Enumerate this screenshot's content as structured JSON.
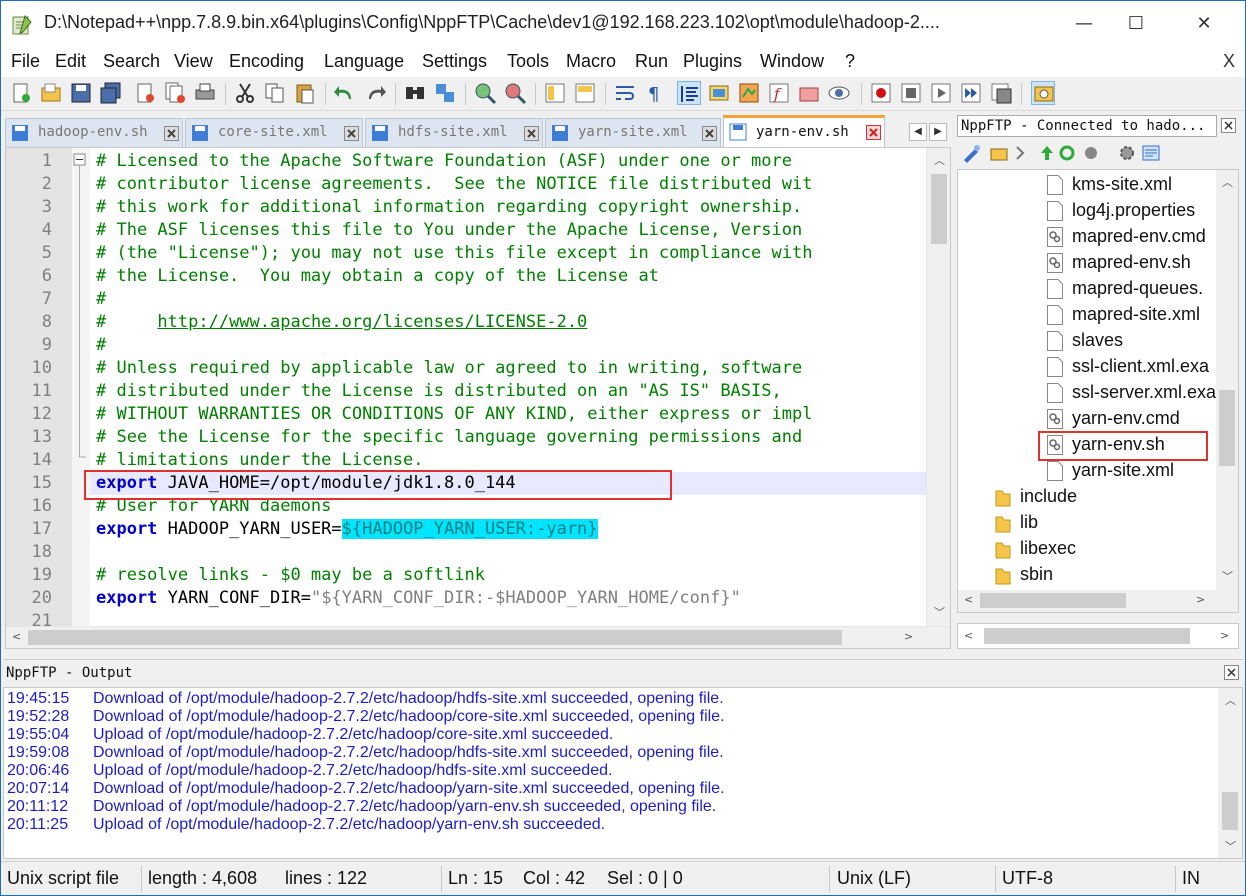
{
  "window": {
    "title": "D:\\Notepad++\\npp.7.8.9.bin.x64\\plugins\\Config\\NppFTP\\Cache\\dev1@192.168.223.102\\opt\\module\\hadoop-2....",
    "minimize": "—",
    "maximize": "☐",
    "close": "✕"
  },
  "menu": {
    "items": [
      "File",
      "Edit",
      "Search",
      "View",
      "Encoding",
      "Language",
      "Settings",
      "Tools",
      "Macro",
      "Run",
      "Plugins",
      "Window",
      "?"
    ],
    "close": "X"
  },
  "tabs": [
    {
      "label": "hadoop-env.sh",
      "active": false
    },
    {
      "label": "core-site.xml",
      "active": false
    },
    {
      "label": "hdfs-site.xml",
      "active": false
    },
    {
      "label": "yarn-site.xml",
      "active": false
    },
    {
      "label": "yarn-env.sh",
      "active": true
    }
  ],
  "tab_scroll": {
    "left": "◀",
    "right": "▶"
  },
  "editor": {
    "line_numbers": [
      "1",
      "2",
      "3",
      "4",
      "5",
      "6",
      "7",
      "8",
      "9",
      "10",
      "11",
      "12",
      "13",
      "14",
      "15",
      "16",
      "17",
      "18",
      "19",
      "20",
      "21"
    ],
    "current_line": 15,
    "lines": [
      {
        "segments": [
          {
            "cls": "cmt",
            "text": "# Licensed to the Apache Software Foundation (ASF) under one or more"
          }
        ]
      },
      {
        "segments": [
          {
            "cls": "cmt",
            "text": "# contributor license agreements.  See the NOTICE file distributed wit"
          }
        ]
      },
      {
        "segments": [
          {
            "cls": "cmt",
            "text": "# this work for additional information regarding copyright ownership."
          }
        ]
      },
      {
        "segments": [
          {
            "cls": "cmt",
            "text": "# The ASF licenses this file to You under the Apache License, Version"
          }
        ]
      },
      {
        "segments": [
          {
            "cls": "cmt",
            "text": "# (the \"License\"); you may not use this file except in compliance with"
          }
        ]
      },
      {
        "segments": [
          {
            "cls": "cmt",
            "text": "# the License.  You may obtain a copy of the License at"
          }
        ]
      },
      {
        "segments": [
          {
            "cls": "cmt",
            "text": "#"
          }
        ]
      },
      {
        "segments": [
          {
            "cls": "cmt",
            "text": "#     "
          },
          {
            "cls": "link",
            "text": "http://www.apache.org/licenses/LICENSE-2.0"
          }
        ]
      },
      {
        "segments": [
          {
            "cls": "cmt",
            "text": "#"
          }
        ]
      },
      {
        "segments": [
          {
            "cls": "cmt",
            "text": "# Unless required by applicable law or agreed to in writing, software"
          }
        ]
      },
      {
        "segments": [
          {
            "cls": "cmt",
            "text": "# distributed under the License is distributed on an \"AS IS\" BASIS,"
          }
        ]
      },
      {
        "segments": [
          {
            "cls": "cmt",
            "text": "# WITHOUT WARRANTIES OR CONDITIONS OF ANY KIND, either express or impl"
          }
        ]
      },
      {
        "segments": [
          {
            "cls": "cmt",
            "text": "# See the License for the specific language governing permissions and"
          }
        ]
      },
      {
        "segments": [
          {
            "cls": "cmt",
            "text": "# limitations under the License."
          }
        ]
      },
      {
        "segments": [
          {
            "cls": "kw",
            "text": "export"
          },
          {
            "cls": "",
            "text": " JAVA_HOME=/opt/module/jdk1.8.0_144"
          }
        ]
      },
      {
        "segments": [
          {
            "cls": "cmt",
            "text": "# User for YARN daemons"
          }
        ]
      },
      {
        "segments": [
          {
            "cls": "kw",
            "text": "export"
          },
          {
            "cls": "",
            "text": " HADOOP_YARN_USER="
          },
          {
            "cls": "hl",
            "text": "${HADOOP_YARN_USER:-yarn}"
          }
        ]
      },
      {
        "segments": [
          {
            "cls": "",
            "text": ""
          }
        ]
      },
      {
        "segments": [
          {
            "cls": "cmt",
            "text": "# resolve links - $0 may be a softlink"
          }
        ]
      },
      {
        "segments": [
          {
            "cls": "kw",
            "text": "export"
          },
          {
            "cls": "",
            "text": " YARN_CONF_DIR="
          },
          {
            "cls": "str",
            "text": "\"${YARN_CONF_DIR:-$HADOOP_YARN_HOME/conf}\""
          }
        ]
      },
      {
        "segments": [
          {
            "cls": "",
            "text": ""
          }
        ]
      }
    ]
  },
  "ftp": {
    "title": "NppFTP - Connected to hado...",
    "tree": [
      {
        "label": "kms-site.xml",
        "icon": "file-icon"
      },
      {
        "label": "log4j.properties",
        "icon": "file-icon"
      },
      {
        "label": "mapred-env.cmd",
        "icon": "script-file-icon"
      },
      {
        "label": "mapred-env.sh",
        "icon": "script-file-icon"
      },
      {
        "label": "mapred-queues.",
        "icon": "file-icon"
      },
      {
        "label": "mapred-site.xml",
        "icon": "file-icon"
      },
      {
        "label": "slaves",
        "icon": "file-icon"
      },
      {
        "label": "ssl-client.xml.exa",
        "icon": "file-icon"
      },
      {
        "label": "ssl-server.xml.exa",
        "icon": "file-icon"
      },
      {
        "label": "yarn-env.cmd",
        "icon": "script-file-icon"
      },
      {
        "label": "yarn-env.sh",
        "icon": "script-file-icon",
        "selected": true
      },
      {
        "label": "yarn-site.xml",
        "icon": "file-icon"
      },
      {
        "label": "include",
        "icon": "folder-icon"
      },
      {
        "label": "lib",
        "icon": "folder-icon"
      },
      {
        "label": "libexec",
        "icon": "folder-icon"
      },
      {
        "label": "sbin",
        "icon": "folder-icon"
      }
    ]
  },
  "output": {
    "title": "NppFTP - Output",
    "lines": [
      {
        "time": "19:45:15",
        "msg": "Download of /opt/module/hadoop-2.7.2/etc/hadoop/hdfs-site.xml succeeded, opening file."
      },
      {
        "time": "19:52:28",
        "msg": "Download of /opt/module/hadoop-2.7.2/etc/hadoop/core-site.xml succeeded, opening file."
      },
      {
        "time": "19:55:04",
        "msg": "Upload of /opt/module/hadoop-2.7.2/etc/hadoop/core-site.xml succeeded."
      },
      {
        "time": "19:59:08",
        "msg": "Download of /opt/module/hadoop-2.7.2/etc/hadoop/hdfs-site.xml succeeded, opening file."
      },
      {
        "time": "20:06:46",
        "msg": "Upload of /opt/module/hadoop-2.7.2/etc/hadoop/hdfs-site.xml succeeded."
      },
      {
        "time": "20:07:14",
        "msg": "Download of /opt/module/hadoop-2.7.2/etc/hadoop/yarn-site.xml succeeded, opening file."
      },
      {
        "time": "20:11:12",
        "msg": "Download of /opt/module/hadoop-2.7.2/etc/hadoop/yarn-env.sh succeeded, opening file."
      },
      {
        "time": "20:11:25",
        "msg": "Upload of /opt/module/hadoop-2.7.2/etc/hadoop/yarn-env.sh succeeded."
      }
    ]
  },
  "status": {
    "file_type": "Unix script file",
    "length": "length : 4,608",
    "lines": "lines : 122",
    "ln": "Ln : 15",
    "col": "Col : 42",
    "sel": "Sel : 0 | 0",
    "eol": "Unix (LF)",
    "encoding": "UTF-8",
    "mode": "IN"
  },
  "colors": {
    "accent_tab": "#f7a035",
    "comment": "#008000",
    "keyword": "#0000d0",
    "highlight": "#00e5ff",
    "output_text": "#1d1dc8",
    "annotation_box": "#e03030"
  }
}
